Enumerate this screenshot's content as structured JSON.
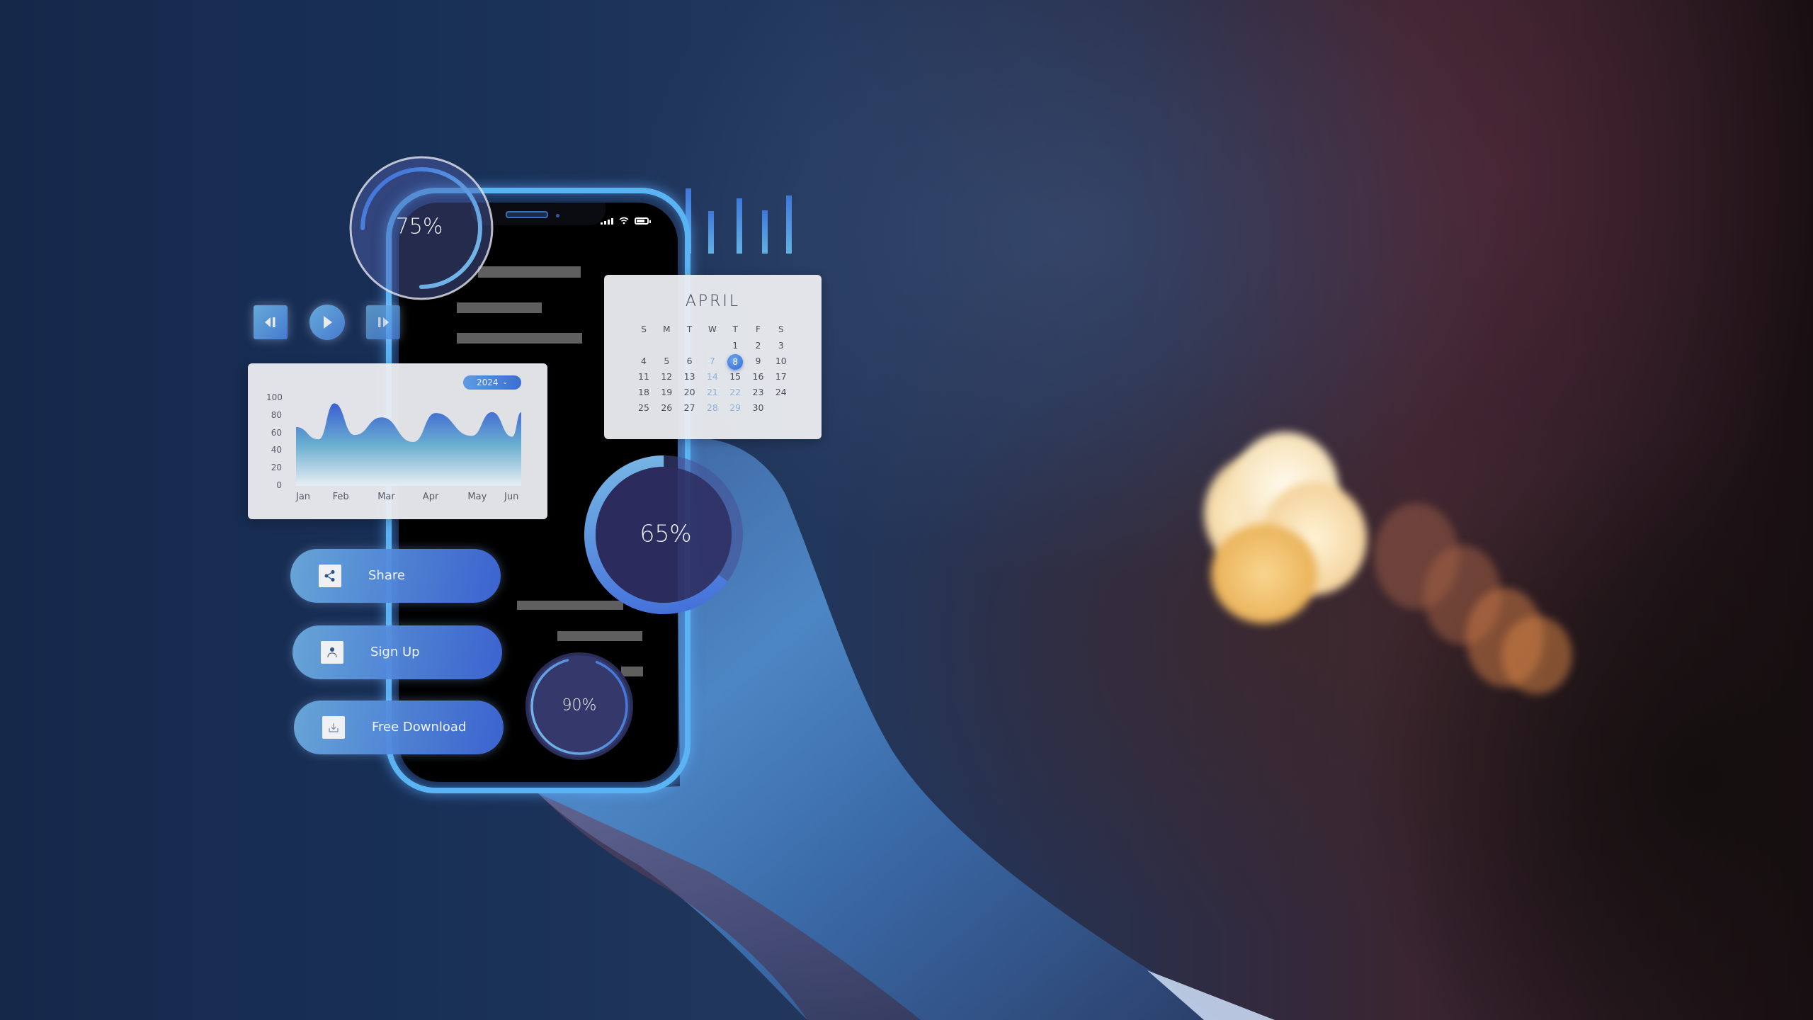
{
  "scene": {
    "description": "Hand holding a smartphone with holographic UI overlays on a dark blue bokeh background",
    "colors": {
      "accent_blue": "#3b6fd3",
      "light_blue": "#6fb8e8",
      "phone_glow": "#5ab3f2",
      "card_bg": "#ecedf0",
      "screen_bg": "#000000",
      "placeholder_bar": "#5f5f5f"
    }
  },
  "phone": {
    "status_bar": {
      "signal_icon": "signal-bars-icon",
      "wifi_icon": "wifi-icon",
      "battery_icon": "battery-icon"
    }
  },
  "gauges": {
    "top_left": {
      "label": "75%",
      "value": 75
    },
    "middle": {
      "label": "65%",
      "value": 65
    },
    "bottom": {
      "label": "90%",
      "value": 90
    }
  },
  "media_controls": {
    "previous_icon": "skip-back-icon",
    "play_icon": "play-icon",
    "next_icon": "skip-forward-icon"
  },
  "area_chart": {
    "year_selector": {
      "selected": "2024",
      "icon": "chevron-down-icon"
    }
  },
  "chart_data": {
    "type": "area",
    "title": "",
    "xlabel": "",
    "ylabel": "",
    "categories": [
      "Jan",
      "Feb",
      "Mar",
      "Apr",
      "May",
      "Jun"
    ],
    "y_ticks": [
      "0",
      "20",
      "40",
      "60",
      "80",
      "100"
    ],
    "ylim": [
      0,
      100
    ],
    "grid": false,
    "legend": "none",
    "series": [
      {
        "name": "2024",
        "x": [
          0.0,
          0.5,
          0.85,
          1.3,
          1.9,
          2.6,
          3.1,
          3.9,
          4.35,
          4.8,
          5.0
        ],
        "values": [
          67,
          53,
          94,
          58,
          78,
          50,
          83,
          57,
          84,
          56,
          84
        ]
      }
    ]
  },
  "calendar": {
    "month": "APRIL",
    "weekdays": [
      "S",
      "M",
      "T",
      "W",
      "T",
      "F",
      "S"
    ],
    "weeks": [
      [
        "",
        "",
        "",
        "",
        "1",
        "2",
        "3"
      ],
      [
        "4",
        "5",
        "6",
        "7",
        "8",
        "9",
        "10"
      ],
      [
        "11",
        "12",
        "13",
        "14",
        "15",
        "16",
        "17"
      ],
      [
        "18",
        "19",
        "20",
        "21",
        "22",
        "23",
        "24"
      ],
      [
        "25",
        "26",
        "27",
        "28",
        "29",
        "30",
        ""
      ]
    ],
    "selected_day": "8"
  },
  "mini_bars": {
    "values": [
      92,
      60,
      78,
      61,
      82
    ]
  },
  "actions": [
    {
      "label": "Share",
      "icon": "share-icon"
    },
    {
      "label": "Sign Up",
      "icon": "user-icon"
    },
    {
      "label": "Free Download",
      "icon": "download-icon"
    }
  ]
}
